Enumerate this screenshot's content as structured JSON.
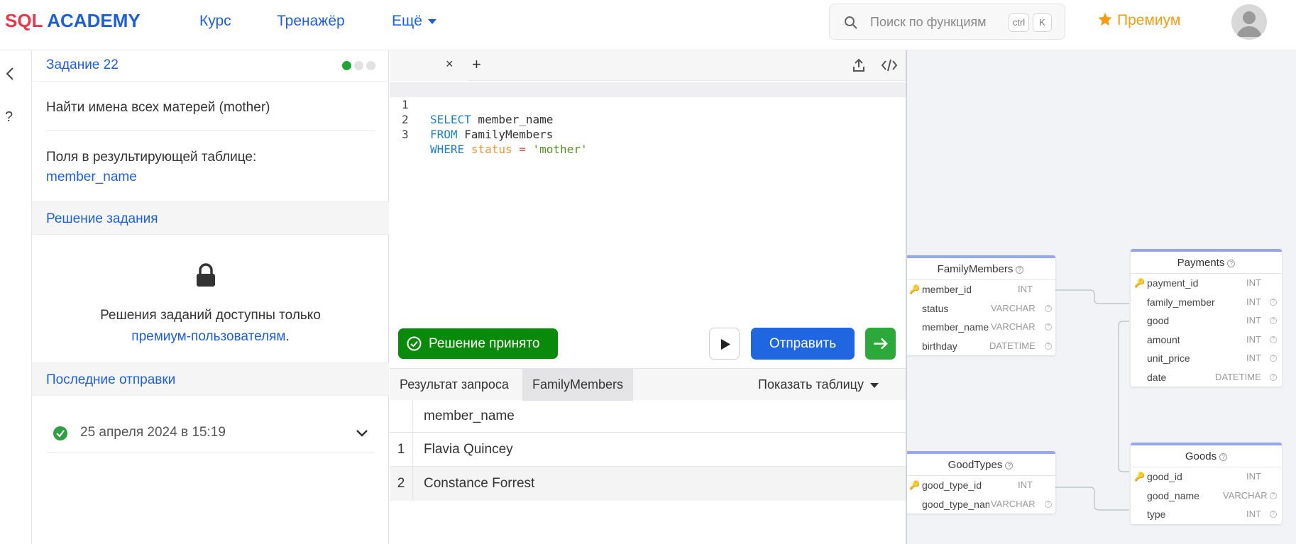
{
  "header": {
    "logo_sql": "SQL",
    "logo_academy": "ACADEMY",
    "nav": [
      "Курс",
      "Тренажёр",
      "Ещё"
    ],
    "search_placeholder": "Поиск по функциям",
    "kbd_ctrl": "ctrl",
    "kbd_k": "K",
    "premium_label": "Премиум"
  },
  "task": {
    "title": "Задание 22",
    "question": "Найти имена всех матерей (mother)",
    "fields_label": "Поля в результирующей таблице:",
    "fields_value": "member_name",
    "solution_header": "Решение задания",
    "locked_line1": "Решения заданий доступны только",
    "locked_link": "премиум-пользователям",
    "locked_end": ".",
    "recent_header": "Последние отправки",
    "submission_date": "25 апреля 2024 в 15:19"
  },
  "editor": {
    "tab_close": "×",
    "tab_add": "+",
    "lines": [
      {
        "n": "1",
        "kw": "SELECT",
        "rest": " member_name"
      },
      {
        "n": "2",
        "kw": "FROM",
        "rest": " FamilyMembers"
      },
      {
        "n": "3",
        "kw": "WHERE",
        "field": "status",
        "op": " = ",
        "str": "'mother'"
      }
    ],
    "accepted_label": "Решение принято",
    "send_label": "Отправить"
  },
  "results": {
    "tabs": [
      "Результат запроса",
      "FamilyMembers"
    ],
    "show_table": "Показать таблицу",
    "column": "member_name",
    "rows": [
      {
        "n": "1",
        "value": "Flavia Quincey"
      },
      {
        "n": "2",
        "value": "Constance Forrest"
      }
    ]
  },
  "schema": {
    "family_members": {
      "name": "FamilyMembers",
      "columns": [
        {
          "name": "member_id",
          "type": "INT"
        },
        {
          "name": "status",
          "type": "VARCHAR"
        },
        {
          "name": "member_name",
          "type": "VARCHAR"
        },
        {
          "name": "birthday",
          "type": "DATETIME"
        }
      ]
    },
    "payments": {
      "name": "Payments",
      "columns": [
        {
          "name": "payment_id",
          "type": "INT"
        },
        {
          "name": "family_member",
          "type": "INT"
        },
        {
          "name": "good",
          "type": "INT"
        },
        {
          "name": "amount",
          "type": "INT"
        },
        {
          "name": "unit_price",
          "type": "INT"
        },
        {
          "name": "date",
          "type": "DATETIME"
        }
      ]
    },
    "good_types": {
      "name": "GoodTypes",
      "columns": [
        {
          "name": "good_type_id",
          "type": "INT"
        },
        {
          "name": "good_type_name",
          "type": "VARCHAR"
        }
      ]
    },
    "goods": {
      "name": "Goods",
      "columns": [
        {
          "name": "good_id",
          "type": "INT"
        },
        {
          "name": "good_name",
          "type": "VARCHAR"
        },
        {
          "name": "type",
          "type": "INT"
        }
      ]
    }
  },
  "colors": {
    "accent": "#1f5fd6",
    "success": "#0a8a0a",
    "premium": "#f39c12",
    "send": "#1f66e0"
  }
}
